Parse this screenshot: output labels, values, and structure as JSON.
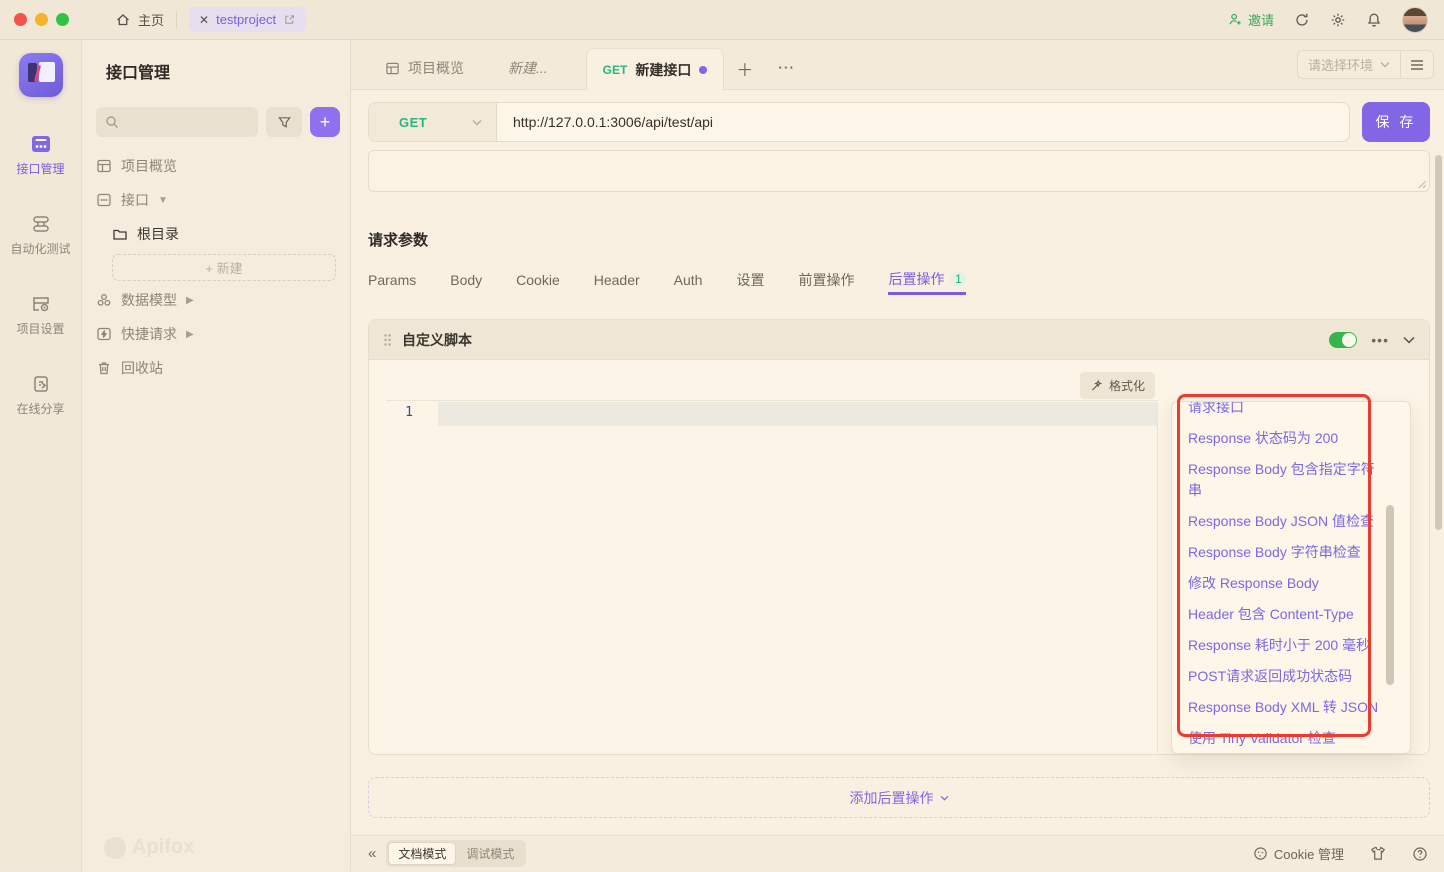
{
  "titlebar": {
    "home_label": "主页",
    "project_tab_label": "testproject",
    "invite_label": "邀请"
  },
  "rail": {
    "items": [
      {
        "label": "接口管理"
      },
      {
        "label": "自动化测试"
      },
      {
        "label": "项目设置"
      },
      {
        "label": "在线分享"
      }
    ]
  },
  "sidebar": {
    "title": "接口管理",
    "tree": {
      "overview": "项目概览",
      "api": "接口",
      "root_folder": "根目录",
      "new_button": "+ 新建",
      "data_model": "数据模型",
      "quick_request": "快捷请求",
      "recycle_bin": "回收站"
    },
    "watermark": "Apifox"
  },
  "main": {
    "tabs": [
      {
        "label": "项目概览"
      },
      {
        "label": "新建..."
      },
      {
        "method": "GET",
        "label": "新建接口"
      }
    ],
    "env_select_placeholder": "请选择环境",
    "request": {
      "method": "GET",
      "url": "http://127.0.0.1:3006/api/test/api",
      "save_label": "保 存"
    },
    "params": {
      "title": "请求参数",
      "tabs": [
        "Params",
        "Body",
        "Cookie",
        "Header",
        "Auth",
        "设置",
        "前置操作",
        "后置操作"
      ],
      "active_tab": "后置操作",
      "badge": "1"
    },
    "script_panel": {
      "title": "自定义脚本",
      "format_label": "格式化",
      "line_number": "1"
    },
    "snippets": {
      "clipped_top_item": "请求接口",
      "items": [
        "Response 状态码为 200",
        "Response Body 包含指定字符串",
        "Response Body JSON 值检查",
        "Response Body 字符串检查",
        "修改 Response Body",
        "Header 包含 Content-Type",
        "Response 耗时小于 200 毫秒",
        "POST请求返回成功状态码",
        "Response Body XML 转 JSON",
        "使用 Tiny Validator 检查"
      ]
    },
    "add_post_action_label": "添加后置操作",
    "footer": {
      "doc_mode": "文档模式",
      "debug_mode": "调试模式",
      "cookie_label": "Cookie 管理"
    }
  },
  "colors": {
    "accent_purple": "#8266e6",
    "method_green": "#26b583",
    "highlight_red": "#ee3b2f"
  }
}
